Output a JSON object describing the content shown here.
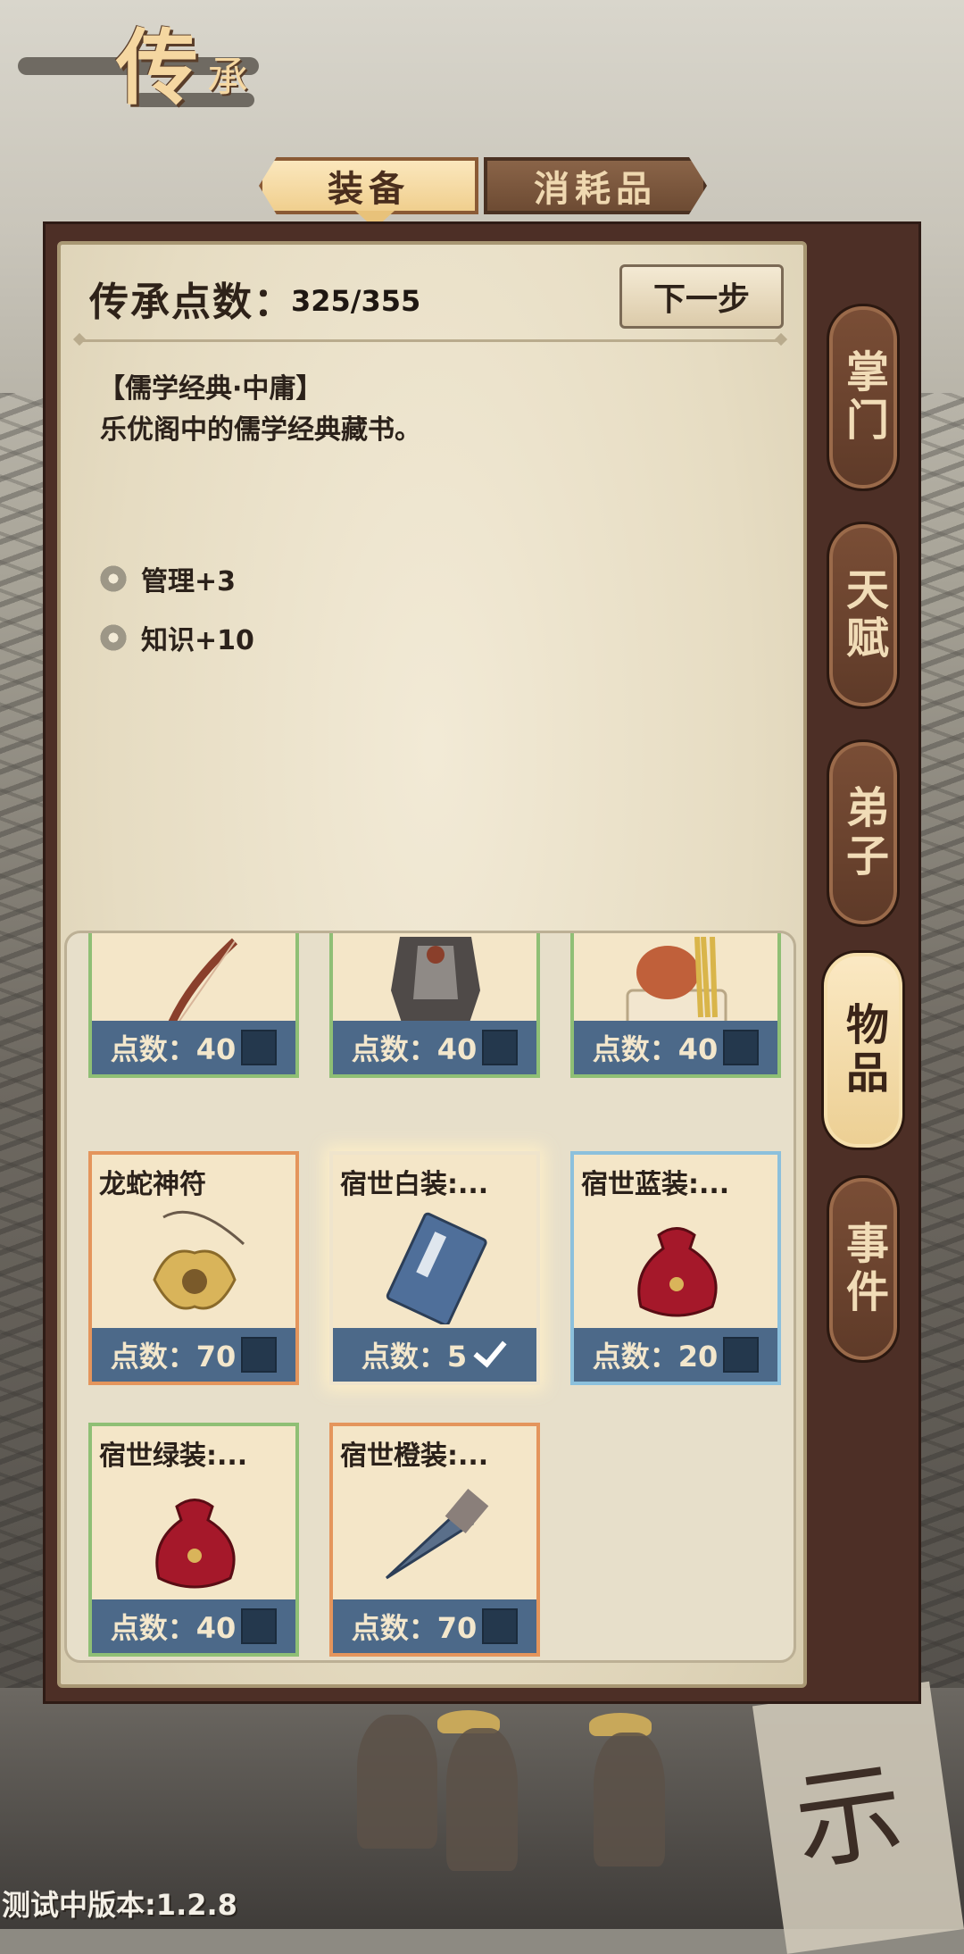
{
  "header": {
    "title_main": "传",
    "title_small": "承"
  },
  "tabs": [
    {
      "label": "装备",
      "active": true
    },
    {
      "label": "消耗品",
      "active": false
    }
  ],
  "inheritance": {
    "points_label": "传承点数：",
    "points_value": "325/355",
    "next_button": "下一步"
  },
  "detail": {
    "title": "【儒学经典·中庸】",
    "description": "乐优阁中的儒学经典藏书。",
    "stats": [
      "管理+3",
      "知识+10"
    ]
  },
  "side_tabs": [
    {
      "label": "掌门",
      "active": false
    },
    {
      "label": "天赋",
      "active": false
    },
    {
      "label": "弟子",
      "active": false
    },
    {
      "label": "物品",
      "active": true
    },
    {
      "label": "事件",
      "active": false
    }
  ],
  "items": [
    {
      "name": "",
      "points": "点数：40",
      "checked": false,
      "rarity": "green",
      "icon": "bow-icon"
    },
    {
      "name": "",
      "points": "点数：40",
      "checked": false,
      "rarity": "green",
      "icon": "armor-icon"
    },
    {
      "name": "",
      "points": "点数：40",
      "checked": false,
      "rarity": "green",
      "icon": "seal-icon"
    },
    {
      "name": "龙蛇神符",
      "points": "点数：70",
      "checked": false,
      "rarity": "orange",
      "icon": "amulet-icon"
    },
    {
      "name": "宿世白装:...",
      "points": "点数：5",
      "checked": true,
      "rarity": "white",
      "icon": "book-icon"
    },
    {
      "name": "宿世蓝装:...",
      "points": "点数：20",
      "checked": false,
      "rarity": "blue",
      "icon": "pouch-icon"
    },
    {
      "name": "宿世绿装:...",
      "points": "点数：40",
      "checked": false,
      "rarity": "green",
      "icon": "pouch-icon"
    },
    {
      "name": "宿世橙装:...",
      "points": "点数：70",
      "checked": false,
      "rarity": "orange",
      "icon": "dart-icon"
    }
  ],
  "footer": {
    "version": "测试中版本:1.2.8"
  },
  "colors": {
    "frame": "#4d2f26",
    "panel": "#e6dcc2",
    "card_footer": "#4c6989",
    "tab_active": "#f0cf8e"
  }
}
